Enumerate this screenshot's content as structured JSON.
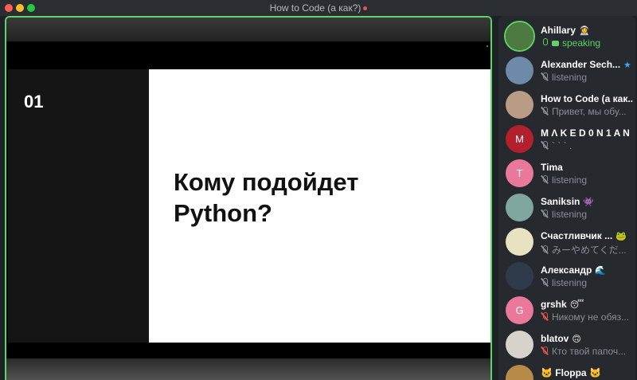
{
  "window": {
    "title": "How to Code (а как?)",
    "recording": true,
    "accent": "#5fd365"
  },
  "slide": {
    "number": "01",
    "line1": "Кому подойдет",
    "line2": "Python?"
  },
  "participants": [
    {
      "name": "Ahillary",
      "badge": "👩‍🚀",
      "status": "speaking",
      "state": "speaking",
      "avatar_color": "#4c7a40",
      "initial": ""
    },
    {
      "name": "Alexander Sech...",
      "badge": "★",
      "status": "listening",
      "state": "listening",
      "avatar_color": "#6d8aa8",
      "initial": ""
    },
    {
      "name": "How to Code (а как...",
      "badge": "",
      "status": "Привет, мы обу...",
      "state": "listening",
      "avatar_color": "#b99c86",
      "initial": ""
    },
    {
      "name": "M Λ K E D 0 N 1 A N",
      "badge": "",
      "status": "` ` ` .",
      "state": "listening",
      "avatar_color": "#b1202c",
      "initial": "M"
    },
    {
      "name": "Tima",
      "badge": "",
      "status": "listening",
      "state": "listening",
      "avatar_color": "#e9789a",
      "initial": "T"
    },
    {
      "name": "Saniksin",
      "badge": "👾",
      "status": "listening",
      "state": "listening",
      "avatar_color": "#7fa7a0",
      "initial": ""
    },
    {
      "name": "Счастливчик ...",
      "badge": "🐸",
      "status": "みーやめてくだ...",
      "state": "listening",
      "avatar_color": "#e8e2c0",
      "initial": ""
    },
    {
      "name": "Александр",
      "badge": "🌊",
      "status": "listening",
      "state": "listening",
      "avatar_color": "#2f3b4a",
      "initial": ""
    },
    {
      "name": "grshk",
      "badge": "😴",
      "status": "Никому не обяз...",
      "state": "muted",
      "avatar_color": "#e9789a",
      "initial": "G"
    },
    {
      "name": "blatov",
      "badge": "🙃",
      "status": "Кто твой папоч...",
      "state": "muted",
      "avatar_color": "#d8d2cc",
      "initial": ""
    },
    {
      "name": "🐱 Floppa 🐱",
      "badge": "",
      "status": "",
      "state": "listening",
      "avatar_color": "#b88a4a",
      "initial": ""
    }
  ]
}
